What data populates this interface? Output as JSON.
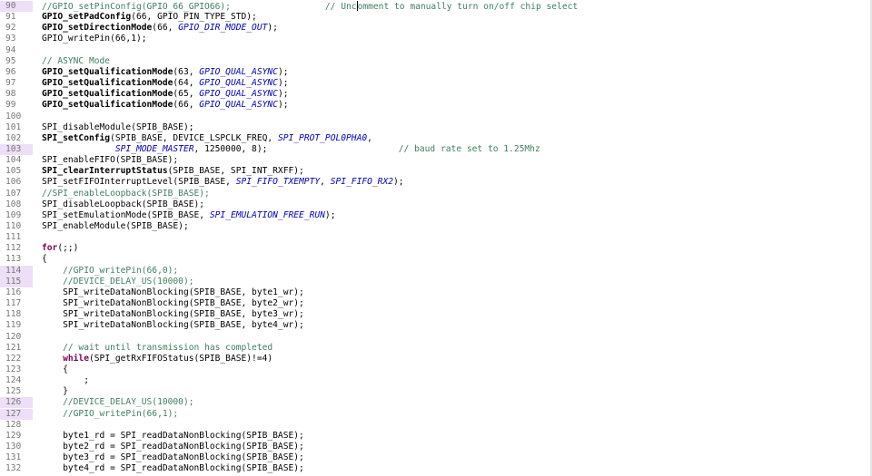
{
  "editor": {
    "lines": [
      {
        "n": "90",
        "marked": true,
        "tokens": [
          [
            "cm",
            "//GPIO_setPinConfig(GPIO_66_GPIO66);                  // Unc"
          ],
          [
            "caret",
            ""
          ],
          [
            "cm",
            "omment to manually turn on/off chip select"
          ]
        ]
      },
      {
        "n": "91",
        "marked": false,
        "tokens": [
          [
            "fn",
            "GPIO_setPadConfig"
          ],
          [
            "",
            "(66, GPIO_PIN_TYPE_STD);"
          ]
        ]
      },
      {
        "n": "92",
        "marked": false,
        "tokens": [
          [
            "fn",
            "GPIO_setDirectionMode"
          ],
          [
            "",
            "(66, "
          ],
          [
            "it",
            "GPIO_DIR_MODE_OUT"
          ],
          [
            "",
            ");"
          ]
        ]
      },
      {
        "n": "93",
        "marked": false,
        "tokens": [
          [
            "",
            "GPIO_writePin(66,1);"
          ]
        ]
      },
      {
        "n": "94",
        "marked": false,
        "tokens": []
      },
      {
        "n": "95",
        "marked": false,
        "tokens": [
          [
            "cm",
            "// ASYNC Mode"
          ]
        ]
      },
      {
        "n": "96",
        "marked": false,
        "tokens": [
          [
            "fn",
            "GPIO_setQualificationMode"
          ],
          [
            "",
            "(63, "
          ],
          [
            "it",
            "GPIO_QUAL_ASYNC"
          ],
          [
            "",
            ");"
          ]
        ]
      },
      {
        "n": "97",
        "marked": false,
        "tokens": [
          [
            "fn",
            "GPIO_setQualificationMode"
          ],
          [
            "",
            "(64, "
          ],
          [
            "it",
            "GPIO_QUAL_ASYNC"
          ],
          [
            "",
            ");"
          ]
        ]
      },
      {
        "n": "98",
        "marked": false,
        "tokens": [
          [
            "fn",
            "GPIO_setQualificationMode"
          ],
          [
            "",
            "(65, "
          ],
          [
            "it",
            "GPIO_QUAL_ASYNC"
          ],
          [
            "",
            ");"
          ]
        ]
      },
      {
        "n": "99",
        "marked": false,
        "tokens": [
          [
            "fn",
            "GPIO_setQualificationMode"
          ],
          [
            "",
            "(66, "
          ],
          [
            "it",
            "GPIO_QUAL_ASYNC"
          ],
          [
            "",
            ");"
          ]
        ]
      },
      {
        "n": "100",
        "marked": false,
        "tokens": []
      },
      {
        "n": "101",
        "marked": false,
        "tokens": [
          [
            "",
            "SPI_disableModule(SPIB_BASE);"
          ]
        ]
      },
      {
        "n": "102",
        "marked": false,
        "tokens": [
          [
            "fn",
            "SPI_setConfig"
          ],
          [
            "",
            "(SPIB_BASE, DEVICE_LSPCLK_FREQ, "
          ],
          [
            "it",
            "SPI_PROT_POL0PHA0"
          ],
          [
            "",
            ","
          ]
        ]
      },
      {
        "n": "103",
        "marked": true,
        "tokens": [
          [
            "",
            "              "
          ],
          [
            "it",
            "SPI_MODE_MASTER"
          ],
          [
            "",
            ", 1250000, 8);                         "
          ],
          [
            "cm",
            "// baud rate set to 1.25Mhz"
          ]
        ]
      },
      {
        "n": "104",
        "marked": false,
        "tokens": [
          [
            "",
            "SPI_enableFIFO(SPIB_BASE);"
          ]
        ]
      },
      {
        "n": "105",
        "marked": false,
        "tokens": [
          [
            "fn",
            "SPI_clearInterruptStatus"
          ],
          [
            "",
            "(SPIB_BASE, SPI_INT_RXFF);"
          ]
        ]
      },
      {
        "n": "106",
        "marked": false,
        "tokens": [
          [
            "",
            "SPI_setFIFOInterruptLevel(SPIB_BASE, "
          ],
          [
            "it",
            "SPI_FIFO_TXEMPTY"
          ],
          [
            "",
            ", "
          ],
          [
            "it",
            "SPI_FIFO_RX2"
          ],
          [
            "",
            ");"
          ]
        ]
      },
      {
        "n": "107",
        "marked": false,
        "tokens": [
          [
            "cm",
            "//SPI_enableLoopback(SPIB_BASE);"
          ]
        ]
      },
      {
        "n": "108",
        "marked": false,
        "tokens": [
          [
            "",
            "SPI_disableLoopback(SPIB_BASE);"
          ]
        ]
      },
      {
        "n": "109",
        "marked": false,
        "tokens": [
          [
            "",
            "SPI_setEmulationMode(SPIB_BASE, "
          ],
          [
            "it",
            "SPI_EMULATION_FREE_RUN"
          ],
          [
            "",
            ");"
          ]
        ]
      },
      {
        "n": "110",
        "marked": false,
        "tokens": [
          [
            "",
            "SPI_enableModule(SPIB_BASE);"
          ]
        ]
      },
      {
        "n": "111",
        "marked": false,
        "tokens": []
      },
      {
        "n": "112",
        "marked": false,
        "tokens": [
          [
            "kw",
            "for"
          ],
          [
            "",
            "(;;)"
          ]
        ]
      },
      {
        "n": "113",
        "marked": false,
        "tokens": [
          [
            "",
            "{"
          ]
        ]
      },
      {
        "n": "114",
        "marked": true,
        "tokens": [
          [
            "",
            "    "
          ],
          [
            "cm",
            "//GPIO_writePin(66,0);"
          ]
        ]
      },
      {
        "n": "115",
        "marked": true,
        "tokens": [
          [
            "",
            "    "
          ],
          [
            "cm",
            "//DEVICE_DELAY_US(10000);"
          ]
        ]
      },
      {
        "n": "116",
        "marked": false,
        "tokens": [
          [
            "",
            "    SPI_writeDataNonBlocking(SPIB_BASE, byte1_wr);"
          ]
        ]
      },
      {
        "n": "117",
        "marked": false,
        "tokens": [
          [
            "",
            "    SPI_writeDataNonBlocking(SPIB_BASE, byte2_wr);"
          ]
        ]
      },
      {
        "n": "118",
        "marked": false,
        "tokens": [
          [
            "",
            "    SPI_writeDataNonBlocking(SPIB_BASE, byte3_wr);"
          ]
        ]
      },
      {
        "n": "119",
        "marked": false,
        "tokens": [
          [
            "",
            "    SPI_writeDataNonBlocking(SPIB_BASE, byte4_wr);"
          ]
        ]
      },
      {
        "n": "120",
        "marked": false,
        "tokens": []
      },
      {
        "n": "121",
        "marked": false,
        "tokens": [
          [
            "",
            "    "
          ],
          [
            "cm",
            "// wait until transmission has completed"
          ]
        ]
      },
      {
        "n": "122",
        "marked": false,
        "tokens": [
          [
            "",
            "    "
          ],
          [
            "kw",
            "while"
          ],
          [
            "",
            "(SPI_getRxFIFOStatus(SPIB_BASE)!=4)"
          ]
        ]
      },
      {
        "n": "123",
        "marked": false,
        "tokens": [
          [
            "",
            "    {"
          ]
        ]
      },
      {
        "n": "124",
        "marked": false,
        "tokens": [
          [
            "",
            "        ;"
          ]
        ]
      },
      {
        "n": "125",
        "marked": false,
        "tokens": [
          [
            "",
            "    }"
          ]
        ]
      },
      {
        "n": "126",
        "marked": true,
        "tokens": [
          [
            "",
            "    "
          ],
          [
            "cm",
            "//DEVICE_DELAY_US(10000);"
          ]
        ]
      },
      {
        "n": "127",
        "marked": true,
        "tokens": [
          [
            "",
            "    "
          ],
          [
            "cm",
            "//GPIO_writePin(66,1);"
          ]
        ]
      },
      {
        "n": "128",
        "marked": false,
        "tokens": []
      },
      {
        "n": "129",
        "marked": false,
        "tokens": [
          [
            "",
            "    byte1_rd = SPI_readDataNonBlocking(SPIB_BASE);"
          ]
        ]
      },
      {
        "n": "130",
        "marked": false,
        "tokens": [
          [
            "",
            "    byte2_rd = SPI_readDataNonBlocking(SPIB_BASE);"
          ]
        ]
      },
      {
        "n": "131",
        "marked": false,
        "tokens": [
          [
            "",
            "    byte3_rd = SPI_readDataNonBlocking(SPIB_BASE);"
          ]
        ]
      },
      {
        "n": "132",
        "marked": false,
        "tokens": [
          [
            "",
            "    byte4_rd = SPI_readDataNonBlocking(SPIB_BASE);"
          ]
        ]
      }
    ]
  },
  "colors": {
    "comment": "#3f7f5f",
    "keyword": "#7f0055",
    "constant": "#0000c0",
    "line_number": "#787878",
    "marked_gutter": "#c8a2e8"
  }
}
